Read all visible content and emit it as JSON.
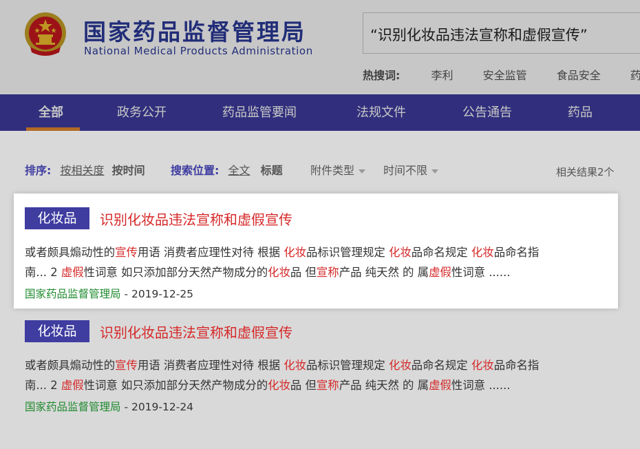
{
  "header": {
    "title_cn": "国家药品监督管理局",
    "title_en": "National Medical Products Administration",
    "search_value": "“识别化妆品违法宣称和虚假宣传”",
    "hot_label": "热搜词:",
    "hot_words": [
      "李利",
      "安全监管",
      "食品安全",
      "药品"
    ]
  },
  "nav": {
    "items": [
      {
        "label": "全部"
      },
      {
        "label": "政务公开"
      },
      {
        "label": "药品监管要闻"
      },
      {
        "label": "法规文件"
      },
      {
        "label": "公告通告"
      },
      {
        "label": "药品"
      }
    ],
    "active_index": 0
  },
  "filters": {
    "sort_label": "排序:",
    "sort_relevance": "按相关度",
    "sort_time": "按时间",
    "position_label": "搜索位置:",
    "position_full": "全文",
    "position_title": "标题",
    "attachment_type": "附件类型",
    "time_range": "时间不限",
    "result_count": "相关结果2个"
  },
  "results": [
    {
      "tag": "化妆品",
      "title": "识别化妆品违法宣称和虚假宣传",
      "line1": [
        {
          "t": "或者颇具煽动性的"
        },
        {
          "t": "宣传",
          "h": true
        },
        {
          "t": "用语 消费者应理性对待 根据 "
        },
        {
          "t": "化妆",
          "h": true
        },
        {
          "t": "品标识管理规定 "
        },
        {
          "t": "化妆",
          "h": true
        },
        {
          "t": "品命名规定 "
        },
        {
          "t": "化妆",
          "h": true
        },
        {
          "t": "品命名指"
        }
      ],
      "line2": [
        {
          "t": "南... 2 "
        },
        {
          "t": "虚假",
          "h": true
        },
        {
          "t": "性词意 如只添加部分天然产物成分的"
        },
        {
          "t": "化妆",
          "h": true
        },
        {
          "t": "品 但"
        },
        {
          "t": "宣称",
          "h": true
        },
        {
          "t": "产品 纯天然 的 属"
        },
        {
          "t": "虚假",
          "h": true
        },
        {
          "t": "性词意 ......"
        }
      ],
      "source": "国家药品监督管理局",
      "date": " - 2019-12-25"
    },
    {
      "tag": "化妆品",
      "title": "识别化妆品违法宣称和虚假宣传",
      "line1": [
        {
          "t": "或者颇具煽动性的"
        },
        {
          "t": "宣传",
          "h": true
        },
        {
          "t": "用语 消费者应理性对待 根据 "
        },
        {
          "t": "化妆",
          "h": true
        },
        {
          "t": "品标识管理规定 "
        },
        {
          "t": "化妆",
          "h": true
        },
        {
          "t": "品命名规定 "
        },
        {
          "t": "化妆",
          "h": true
        },
        {
          "t": "品命名指"
        }
      ],
      "line2": [
        {
          "t": "南... 2 "
        },
        {
          "t": "虚假",
          "h": true
        },
        {
          "t": "性词意 如只添加部分天然产物成分的"
        },
        {
          "t": "化妆",
          "h": true
        },
        {
          "t": "品 但"
        },
        {
          "t": "宣称",
          "h": true
        },
        {
          "t": "产品 纯天然 的 属"
        },
        {
          "t": "虚假",
          "h": true
        },
        {
          "t": "性词意 ......"
        }
      ],
      "source": "国家药品监督管理局",
      "date": " - 2019-12-24"
    }
  ],
  "colors": {
    "brand_blue": "#3f3da0",
    "highlight_red": "#d62828",
    "source_green": "#1f8a2e",
    "active_underline": "#e68a2e"
  },
  "icons": {
    "emblem": "national-emblem-icon",
    "caret": "caret-down-icon"
  }
}
